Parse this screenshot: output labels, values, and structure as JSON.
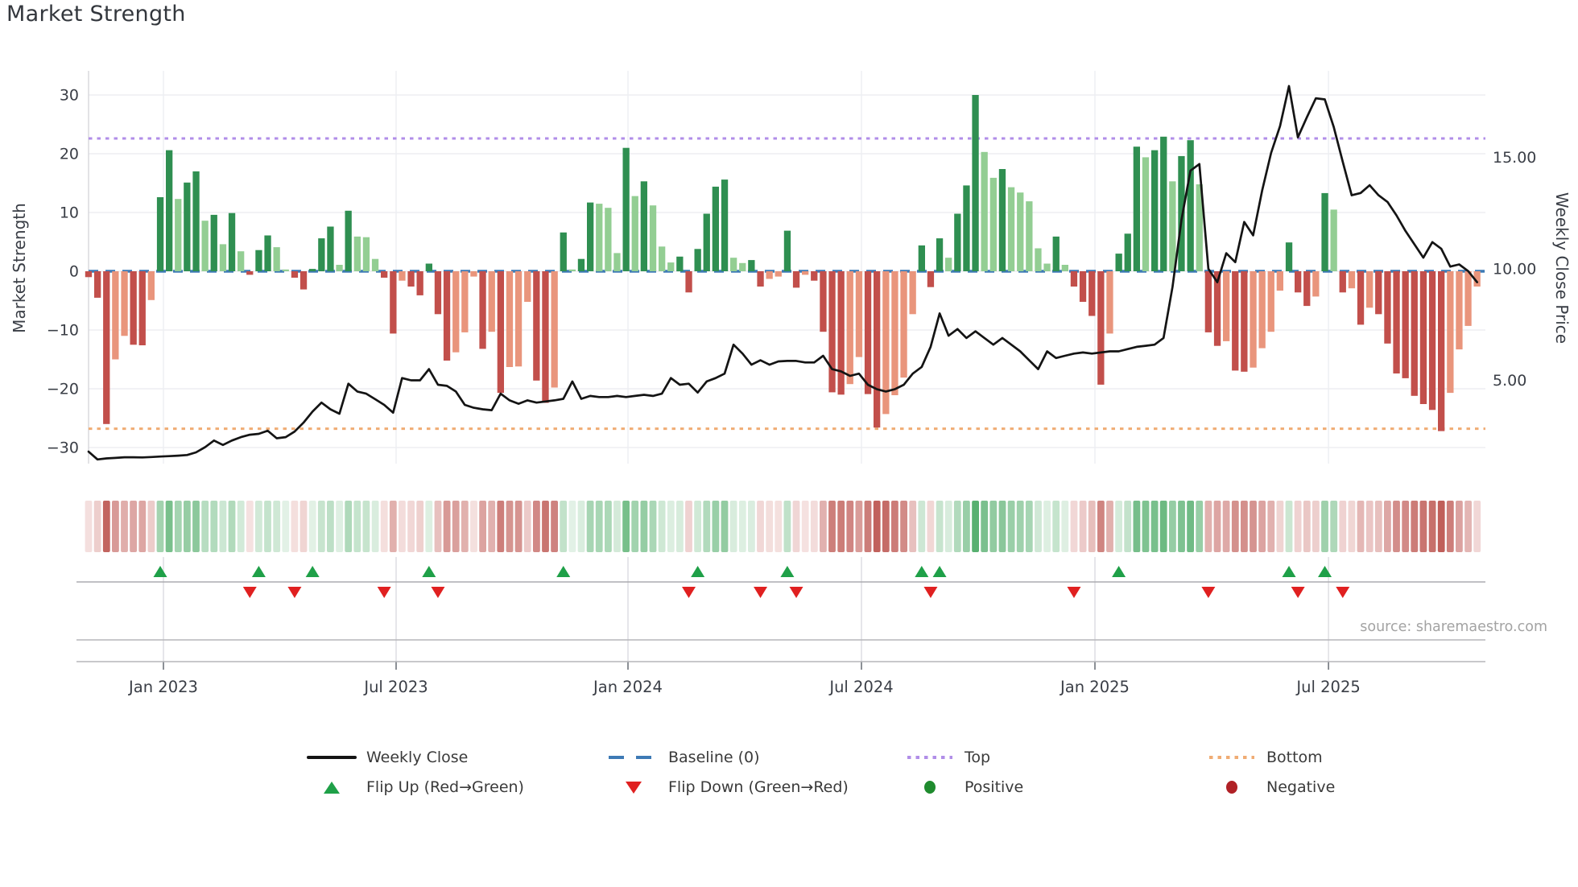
{
  "title": "Market Strength",
  "source": "source: sharemaestro.com",
  "colors": {
    "dark_green": "#2f8f51",
    "light_green": "#93ce93",
    "dark_red": "#c24f4b",
    "light_red": "#e9957c",
    "line": "#141414",
    "baseline": "#3d7ab5",
    "top_line": "#b18ee8",
    "bottom_line": "#f0ac74",
    "flip_up": "#1fa048",
    "flip_down": "#e02020",
    "positive": "#1f8b2e",
    "negative": "#b02126",
    "grid": "#edeef2",
    "rule": "#b5b5ba",
    "axis_text": "#3a3e46"
  },
  "axes": {
    "y_left": {
      "label": "Market Strength",
      "tick_values": [
        30,
        20,
        10,
        0,
        -10,
        -20,
        -30
      ],
      "tick_labels": [
        "30",
        "20",
        "10",
        "0",
        "−10",
        "−20",
        "−30"
      ]
    },
    "y_right": {
      "label": "Weekly Close Price",
      "tick_values": [
        15,
        10,
        5
      ],
      "tick_labels": [
        "15.00",
        "10.00",
        "5.00"
      ]
    },
    "x": {
      "ticks": [
        {
          "label": "Jan 2023",
          "week": 8.36
        },
        {
          "label": "Jul 2023",
          "week": 34.33
        },
        {
          "label": "Jan 2024",
          "week": 60.21
        },
        {
          "label": "Jul 2024",
          "week": 86.28
        },
        {
          "label": "Jan 2025",
          "week": 112.34
        },
        {
          "label": "Jul 2025",
          "week": 138.41
        }
      ]
    }
  },
  "legend": {
    "row1": [
      {
        "label": "Weekly Close"
      },
      {
        "label": "Baseline (0)"
      },
      {
        "label": "Top"
      },
      {
        "label": "Bottom"
      }
    ],
    "row2": [
      {
        "label": "Flip Up (Red→Green)"
      },
      {
        "label": "Flip Down (Green→Red)"
      },
      {
        "label": "Positive"
      },
      {
        "label": "Negative"
      }
    ]
  },
  "chart_data": {
    "type": "combo-bar-line-heatmap",
    "x_unit": "week",
    "n_weeks": 156,
    "baseline": 0,
    "top_threshold": 22.6,
    "bottom_threshold": -26.8,
    "ylim_left": [
      -32.6,
      33.8
    ],
    "y_right_ticks": [
      5,
      10,
      15
    ],
    "strength_bars": [
      -1.0,
      -4.5,
      -26.0,
      -15.0,
      -11.0,
      -12.5,
      -12.6,
      -4.9,
      12.6,
      20.6,
      12.3,
      15.1,
      17.0,
      8.6,
      9.6,
      4.6,
      9.9,
      3.4,
      -0.6,
      3.6,
      6.1,
      4.1,
      0.3,
      -1.1,
      -3.1,
      0.4,
      5.6,
      7.6,
      1.1,
      10.3,
      5.9,
      5.8,
      2.1,
      -1.1,
      -10.6,
      -1.6,
      -2.6,
      -4.1,
      1.3,
      -7.3,
      -15.2,
      -13.8,
      -10.4,
      -0.9,
      -13.2,
      -10.3,
      -20.7,
      -16.3,
      -16.2,
      -5.2,
      -18.6,
      -22.4,
      -19.8,
      6.6,
      0.3,
      2.1,
      11.7,
      11.5,
      10.8,
      3.1,
      21.0,
      12.8,
      15.3,
      11.2,
      4.2,
      1.5,
      2.5,
      -3.6,
      3.8,
      9.8,
      14.4,
      15.6,
      2.3,
      1.4,
      1.9,
      -2.6,
      -1.3,
      -0.9,
      6.9,
      -2.8,
      -0.6,
      -1.6,
      -10.3,
      -20.6,
      -21.0,
      -19.2,
      -14.6,
      -20.9,
      -26.6,
      -24.3,
      -21.1,
      -18.1,
      -7.3,
      4.4,
      -2.7,
      5.6,
      2.3,
      9.8,
      14.6,
      30.0,
      20.3,
      15.9,
      17.4,
      14.3,
      13.4,
      11.9,
      3.9,
      1.3,
      5.9,
      1.1,
      -2.6,
      -5.2,
      -7.6,
      -19.3,
      -10.6,
      3.0,
      6.4,
      21.2,
      19.4,
      20.6,
      22.9,
      15.3,
      19.6,
      22.3,
      14.8,
      -10.4,
      -12.7,
      -11.9,
      -16.9,
      -17.1,
      -16.4,
      -13.1,
      -10.3,
      -3.3,
      4.9,
      -3.6,
      -5.9,
      -4.3,
      13.3,
      10.5,
      -3.6,
      -2.9,
      -9.1,
      -6.2,
      -7.3,
      -12.3,
      -17.4,
      -18.2,
      -21.2,
      -22.6,
      -23.6,
      -27.2,
      -20.7,
      -13.3,
      -9.3,
      -2.6
    ],
    "weekly_close": [
      1.8,
      1.45,
      1.5,
      1.52,
      1.55,
      1.55,
      1.54,
      1.56,
      1.58,
      1.6,
      1.62,
      1.65,
      1.77,
      2.0,
      2.3,
      2.1,
      2.3,
      2.45,
      2.56,
      2.6,
      2.74,
      2.4,
      2.45,
      2.7,
      3.1,
      3.6,
      4.0,
      3.7,
      3.5,
      4.85,
      4.5,
      4.4,
      4.15,
      3.9,
      3.55,
      5.1,
      5.0,
      5.0,
      5.5,
      4.8,
      4.75,
      4.5,
      3.9,
      3.77,
      3.7,
      3.66,
      4.4,
      4.1,
      3.95,
      4.1,
      4.0,
      4.05,
      4.1,
      4.17,
      4.95,
      4.17,
      4.3,
      4.25,
      4.25,
      4.3,
      4.25,
      4.3,
      4.35,
      4.3,
      4.4,
      5.1,
      4.8,
      4.85,
      4.45,
      4.95,
      5.1,
      5.3,
      6.6,
      6.2,
      5.7,
      5.9,
      5.7,
      5.85,
      5.87,
      5.87,
      5.8,
      5.8,
      6.1,
      5.5,
      5.4,
      5.2,
      5.3,
      4.8,
      4.6,
      4.5,
      4.6,
      4.8,
      5.3,
      5.6,
      6.5,
      8.0,
      7.0,
      7.3,
      6.9,
      7.2,
      6.9,
      6.6,
      6.9,
      6.6,
      6.3,
      5.9,
      5.5,
      6.3,
      6.0,
      6.1,
      6.2,
      6.25,
      6.2,
      6.25,
      6.3,
      6.3,
      6.4,
      6.5,
      6.55,
      6.6,
      6.9,
      9.2,
      12.2,
      14.4,
      14.7,
      10.0,
      9.4,
      10.7,
      10.3,
      12.1,
      11.5,
      13.5,
      15.2,
      16.4,
      18.2,
      15.9,
      16.8,
      17.65,
      17.6,
      16.35,
      14.8,
      13.3,
      13.4,
      13.75,
      13.3,
      13.0,
      12.4,
      11.7,
      11.1,
      10.5,
      11.2,
      10.9,
      10.1,
      10.2,
      9.9,
      9.4
    ]
  }
}
